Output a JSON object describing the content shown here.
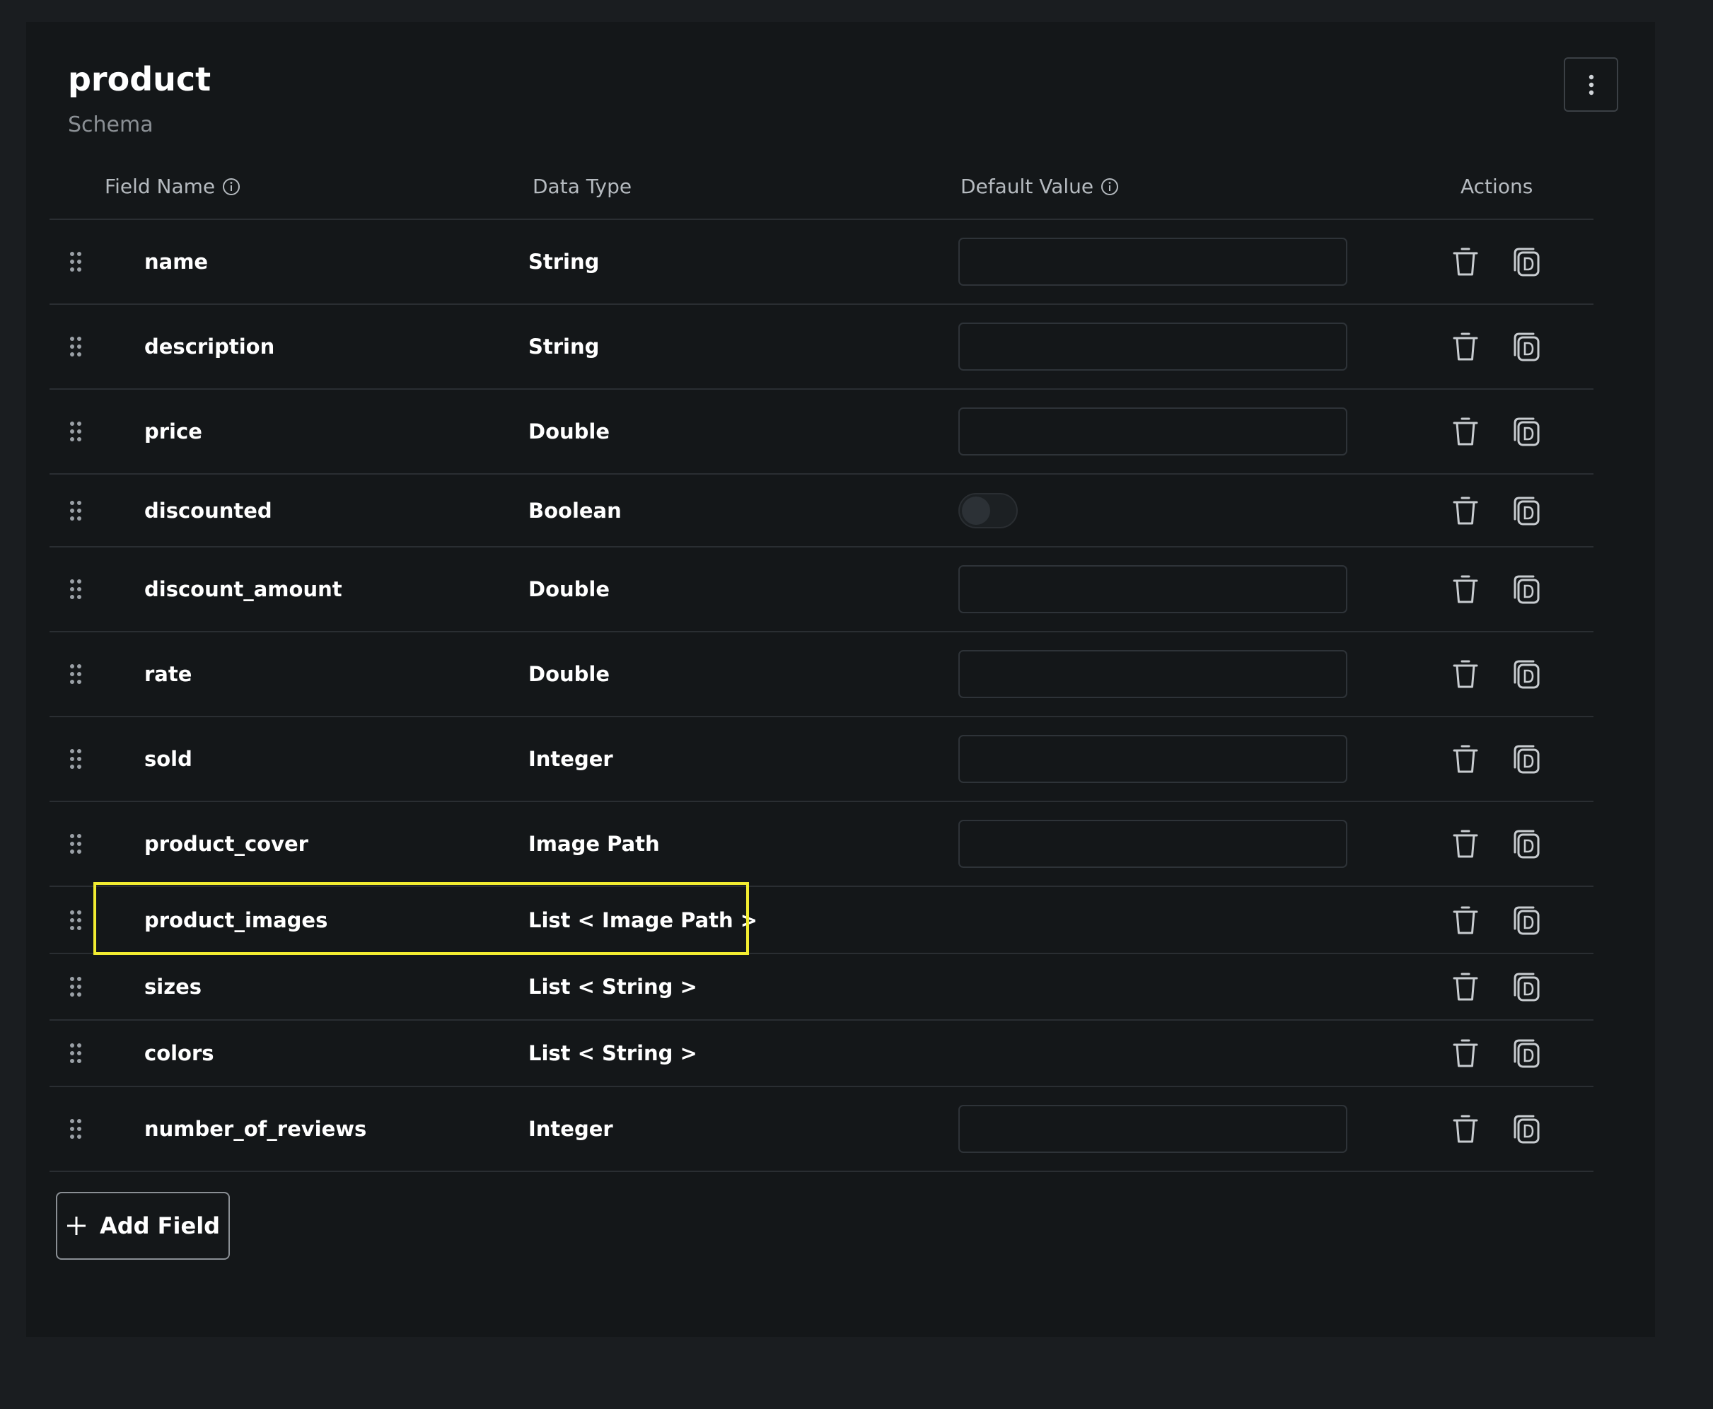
{
  "header": {
    "title": "product",
    "subtitle": "Schema"
  },
  "columns": {
    "field_name": "Field Name",
    "data_type": "Data Type",
    "default_value": "Default Value",
    "actions": "Actions"
  },
  "fields": [
    {
      "name": "name",
      "type": "String",
      "default": "input"
    },
    {
      "name": "description",
      "type": "String",
      "default": "input"
    },
    {
      "name": "price",
      "type": "Double",
      "default": "input"
    },
    {
      "name": "discounted",
      "type": "Boolean",
      "default": "toggle"
    },
    {
      "name": "discount_amount",
      "type": "Double",
      "default": "input"
    },
    {
      "name": "rate",
      "type": "Double",
      "default": "input"
    },
    {
      "name": "sold",
      "type": "Integer",
      "default": "input"
    },
    {
      "name": "product_cover",
      "type": "Image Path",
      "default": "input"
    },
    {
      "name": "product_images",
      "type": "List < Image Path >",
      "default": "none"
    },
    {
      "name": "sizes",
      "type": "List < String >",
      "default": "none"
    },
    {
      "name": "colors",
      "type": "List < String >",
      "default": "none"
    },
    {
      "name": "number_of_reviews",
      "type": "Integer",
      "default": "input"
    }
  ],
  "add_button": {
    "label": "Add Field"
  },
  "icons": {
    "more": "vertical-dots-icon",
    "info": "info-icon",
    "drag": "drag-handle-icon",
    "delete": "trash-icon",
    "duplicate": "duplicate-icon",
    "add": "plus-icon"
  },
  "colors": {
    "background": "#1a1d20",
    "panel": "#141719",
    "highlight": "#f2ec31"
  }
}
